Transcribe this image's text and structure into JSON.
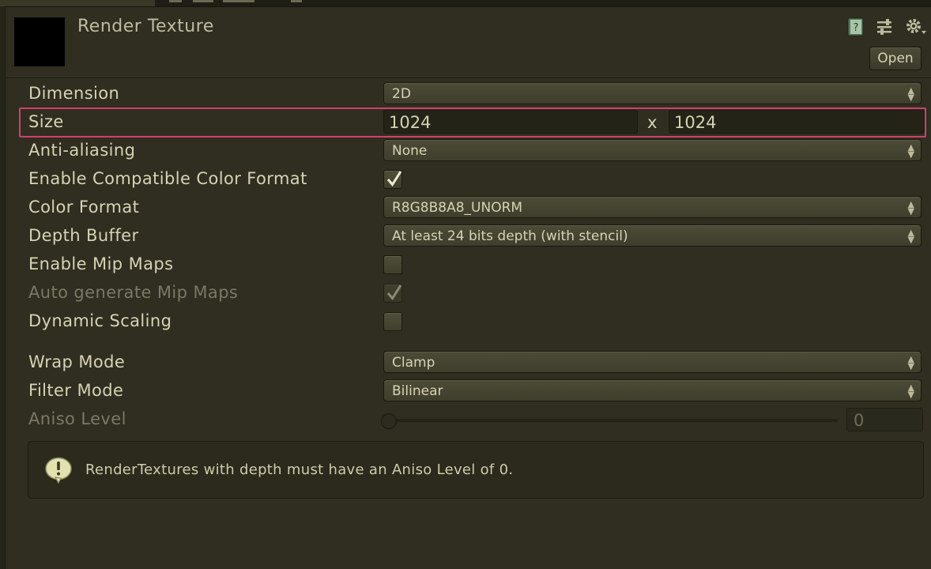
{
  "header": {
    "title": "Render Texture",
    "open_label": "Open",
    "icons": [
      "help-book-icon",
      "preset-sliders-icon",
      "settings-gear-icon"
    ]
  },
  "properties": {
    "dimension": {
      "label": "Dimension",
      "value": "2D"
    },
    "size": {
      "label": "Size",
      "width": "1024",
      "separator": "x",
      "height": "1024"
    },
    "anti_aliasing": {
      "label": "Anti-aliasing",
      "value": "None"
    },
    "compatible_color_format": {
      "label": "Enable Compatible Color Format",
      "checked": true
    },
    "color_format": {
      "label": "Color Format",
      "value": "R8G8B8A8_UNORM"
    },
    "depth_buffer": {
      "label": "Depth Buffer",
      "value": "At least 24 bits depth (with stencil)"
    },
    "mip_maps": {
      "label": "Enable Mip Maps",
      "checked": false
    },
    "auto_mip_maps": {
      "label": "Auto generate Mip Maps",
      "checked": true,
      "disabled": true
    },
    "dynamic_scaling": {
      "label": "Dynamic Scaling",
      "checked": false
    },
    "wrap_mode": {
      "label": "Wrap Mode",
      "value": "Clamp"
    },
    "filter_mode": {
      "label": "Filter Mode",
      "value": "Bilinear"
    },
    "aniso_level": {
      "label": "Aniso Level",
      "value": "0",
      "disabled": true
    }
  },
  "help": {
    "icon": "warning-speech-icon",
    "text": "RenderTextures with depth must have an Aniso Level of 0."
  },
  "colors": {
    "background": "#2f2e20",
    "highlight": "#d0406e",
    "text": "#d6d3b4"
  }
}
